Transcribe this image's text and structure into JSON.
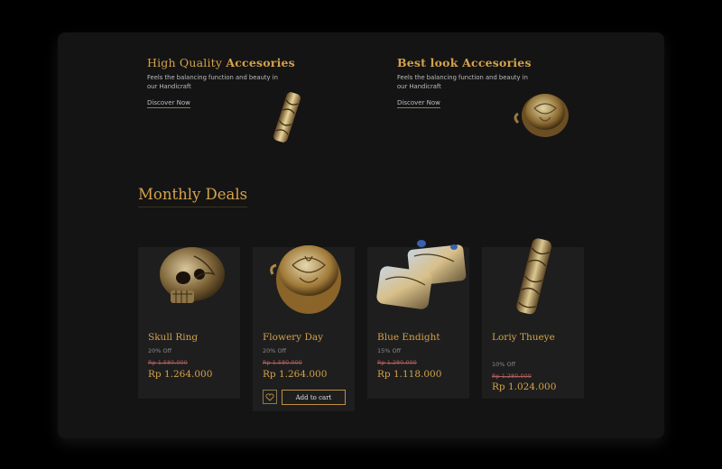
{
  "promos": [
    {
      "title_light": "High Quality",
      "title_bold": "Accesories",
      "desc": "Feels the balancing function and beauty in our Handicraft",
      "link": "Discover Now",
      "image_icon": "gold-cylinder-pendant"
    },
    {
      "title_light": "",
      "title_bold": "Best look Accesories",
      "desc": "Feels the balancing function and beauty in our Handicraft",
      "link": "Discover Now",
      "image_icon": "gold-engraved-ring"
    }
  ],
  "section_title": "Monthly Deals",
  "products": [
    {
      "name": "Skull Ring",
      "discount": "20% Off",
      "old_price": "Rp 1.580.000",
      "price": "Rp 1.264.000",
      "image_icon": "skull-ring"
    },
    {
      "name": "Flowery Day",
      "discount": "20% Off",
      "old_price": "Rp 1.580.000",
      "price": "Rp 1.264.000",
      "image_icon": "flower-engraved-ring",
      "add_to_cart": "Add to cart"
    },
    {
      "name": "Blue Endight",
      "discount": "15% Off",
      "old_price": "Rp 1.280.000",
      "price": "Rp 1.118.000",
      "image_icon": "blue-stone-rings"
    },
    {
      "name": "Loriy Thueye",
      "discount": "10% Off",
      "old_price": "Rp 1.280.000",
      "price": "Rp 1.024.000",
      "image_icon": "cylinder-pendant"
    }
  ],
  "colors": {
    "accent": "#d4a24a",
    "background": "#141414",
    "card": "#1e1e1e",
    "strike": "#b06060"
  }
}
